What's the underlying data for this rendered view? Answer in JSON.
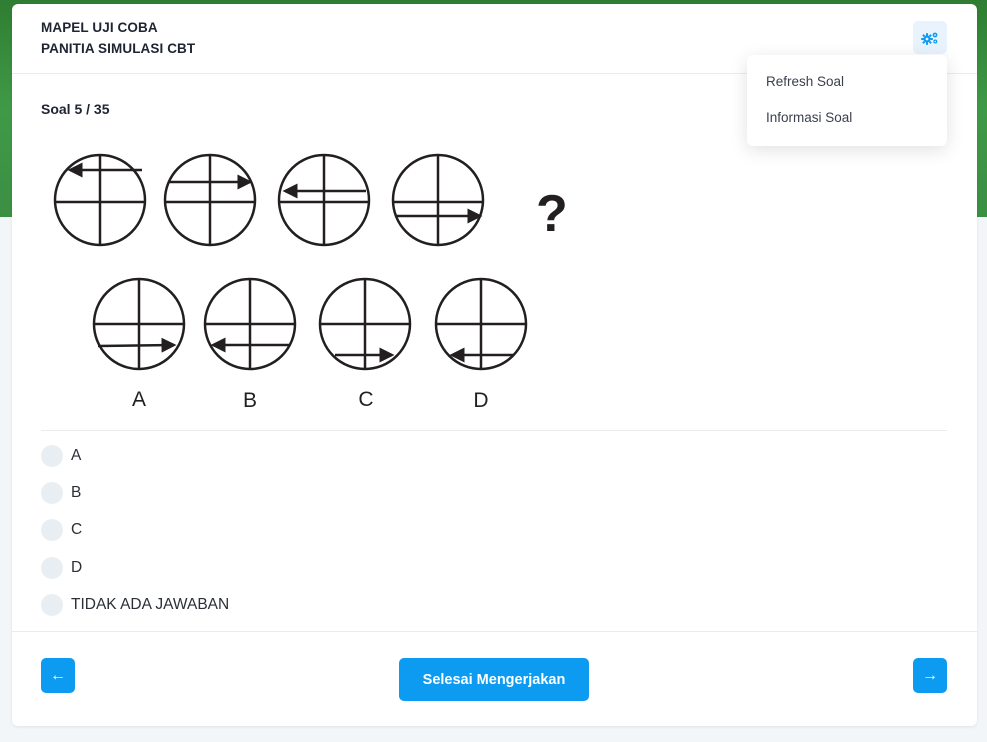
{
  "header": {
    "title_line1": "MAPEL UJI COBA",
    "title_line2": "PANITIA SIMULASI CBT"
  },
  "settings_menu": {
    "icon": "gears-icon",
    "items": [
      {
        "label": "Refresh Soal"
      },
      {
        "label": "Informasi Soal"
      }
    ]
  },
  "question": {
    "number_text": "Soal 5 / 35",
    "image": {
      "question_mark": "?",
      "answer_labels": [
        "A",
        "B",
        "C",
        "D"
      ]
    }
  },
  "options": [
    {
      "label": "A"
    },
    {
      "label": "B"
    },
    {
      "label": "C"
    },
    {
      "label": "D"
    },
    {
      "label": "TIDAK ADA JAWABAN"
    }
  ],
  "footer": {
    "prev_icon": "arrow-left-icon",
    "prev_symbol": "←",
    "next_icon": "arrow-right-icon",
    "next_symbol": "→",
    "finish_label": "Selesai Mengerjakan"
  },
  "colors": {
    "accent": "#0d9bf2",
    "header_bg": "#3f9a47"
  }
}
